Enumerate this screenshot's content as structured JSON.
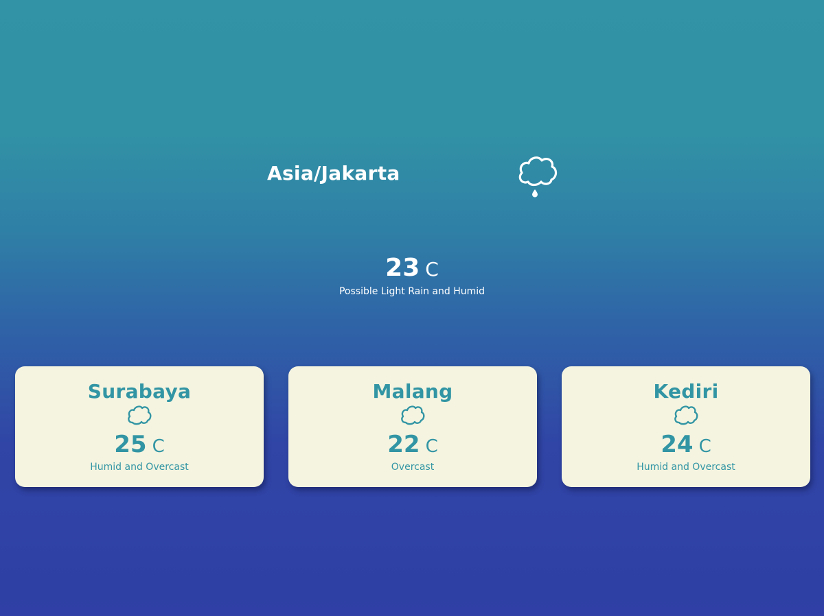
{
  "current": {
    "location": "Asia/Jakarta",
    "icon": "cloud-rain-icon",
    "temperature": "23",
    "unit": "C",
    "description": "Possible Light Rain and Humid"
  },
  "cities": [
    {
      "name": "Surabaya",
      "icon": "cloud-icon",
      "temperature": "25",
      "unit": "C",
      "description": "Humid and Overcast"
    },
    {
      "name": "Malang",
      "icon": "cloud-icon",
      "temperature": "22",
      "unit": "C",
      "description": "Overcast"
    },
    {
      "name": "Kediri",
      "icon": "cloud-icon",
      "temperature": "24",
      "unit": "C",
      "description": "Humid and Overcast"
    }
  ],
  "colors": {
    "background_top": "#3193a5",
    "background_bottom": "#2f3fa5",
    "card_background": "#f4f4e0",
    "card_accent": "#3295a4",
    "text_light": "#ffffff"
  }
}
